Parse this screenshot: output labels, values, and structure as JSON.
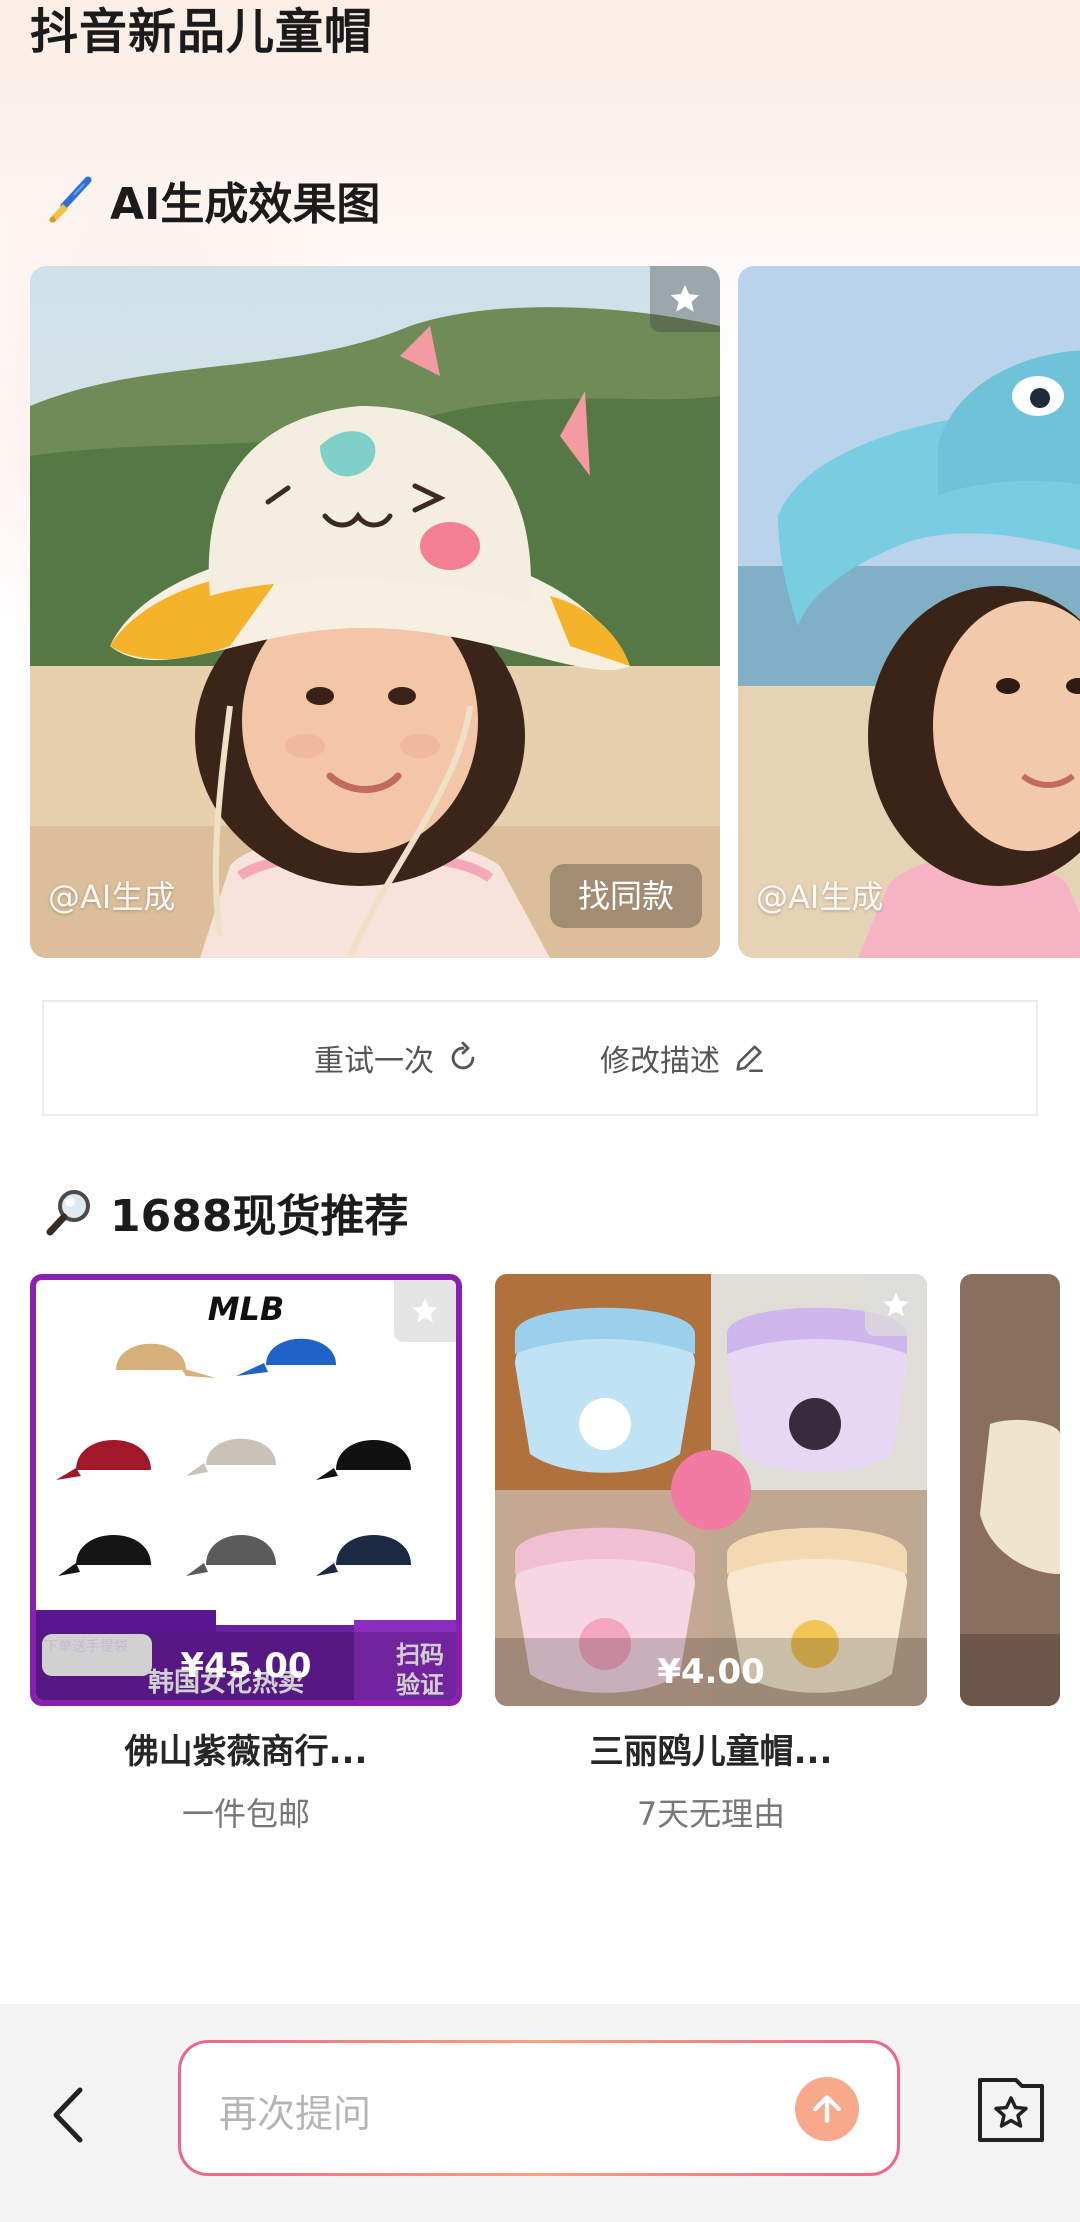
{
  "page_title": "抖音新品儿童帽",
  "ai_section": {
    "title": "AI生成效果图",
    "icon": "paintbrush-icon",
    "cards": [
      {
        "watermark": "@AI生成",
        "find_same": "找同款"
      },
      {
        "watermark": "@AI生成"
      }
    ]
  },
  "actions": {
    "retry": "重试一次",
    "edit": "修改描述"
  },
  "rec_section": {
    "title": "1688现货推荐",
    "icon": "magnifier-icon",
    "products": [
      {
        "price": "¥45.00",
        "name": "佛山紫薇商行...",
        "tag": "一件包邮",
        "brand": "MLB",
        "banner": "韩国女花热卖",
        "banner_small": "下单送手提袋",
        "scan": "扫码验证"
      },
      {
        "price": "¥4.00",
        "name": "三丽鸥儿童帽...",
        "tag": "7天无理由"
      }
    ]
  },
  "bottom": {
    "placeholder": "再次提问"
  },
  "colors": {
    "accent": "#f8a98b",
    "border_gradient": [
      "#f0638a",
      "#f7a37b"
    ]
  }
}
